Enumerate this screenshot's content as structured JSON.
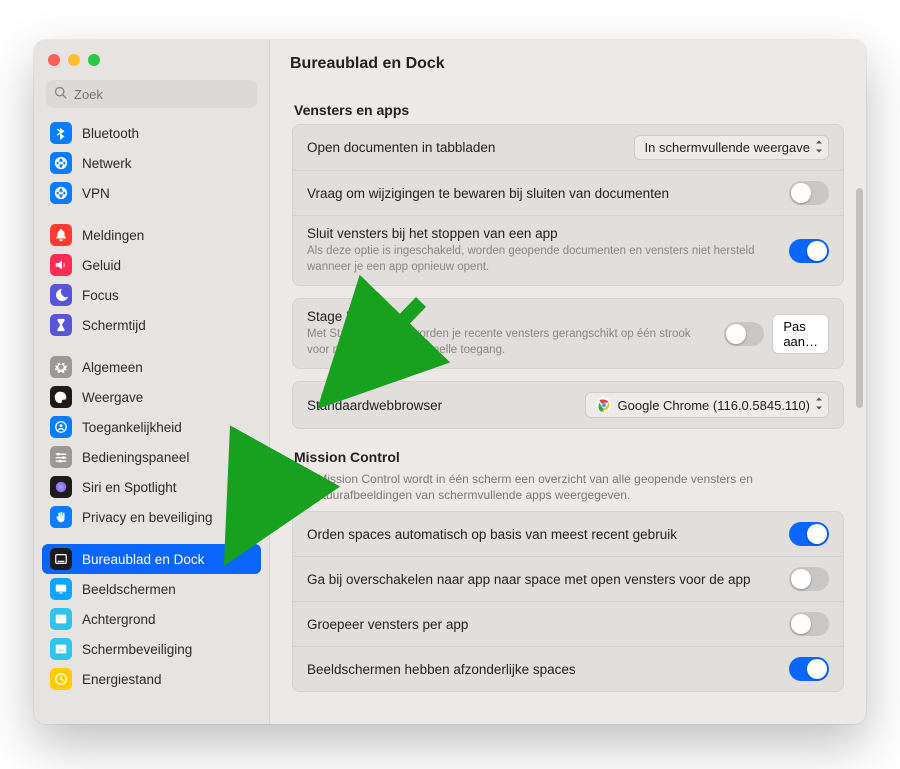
{
  "window": {
    "title": "Bureaublad en Dock"
  },
  "search": {
    "placeholder": "Zoek"
  },
  "sidebar": {
    "groups": [
      [
        {
          "id": "bluetooth",
          "label": "Bluetooth",
          "color": "#0a7cff",
          "icon": "bluetooth"
        },
        {
          "id": "network",
          "label": "Netwerk",
          "color": "#0a7cff",
          "icon": "globe"
        },
        {
          "id": "vpn",
          "label": "VPN",
          "color": "#0a7cff",
          "icon": "globe"
        }
      ],
      [
        {
          "id": "notifications",
          "label": "Meldingen",
          "color": "#ff3b30",
          "icon": "bell"
        },
        {
          "id": "sound",
          "label": "Geluid",
          "color": "#ff2d55",
          "icon": "speaker"
        },
        {
          "id": "focus",
          "label": "Focus",
          "color": "#5856d6",
          "icon": "moon"
        },
        {
          "id": "screentime",
          "label": "Schermtijd",
          "color": "#5856d6",
          "icon": "hourglass"
        }
      ],
      [
        {
          "id": "general",
          "label": "Algemeen",
          "color": "#9b9895",
          "icon": "gear"
        },
        {
          "id": "appearance",
          "label": "Weergave",
          "color": "#1c1c1c",
          "icon": "appearance"
        },
        {
          "id": "accessibility",
          "label": "Toegankelijkheid",
          "color": "#0a7cff",
          "icon": "person"
        },
        {
          "id": "controlcenter",
          "label": "Bedieningspaneel",
          "color": "#9b9895",
          "icon": "sliders"
        },
        {
          "id": "siri",
          "label": "Siri en Spotlight",
          "color": "#1c1c1c",
          "icon": "siri"
        },
        {
          "id": "privacy",
          "label": "Privacy en beveiliging",
          "color": "#0a7cff",
          "icon": "hand"
        }
      ],
      [
        {
          "id": "desktop",
          "label": "Bureaublad en Dock",
          "color": "#1c1c1c",
          "icon": "dock",
          "selected": true
        },
        {
          "id": "displays",
          "label": "Beeldschermen",
          "color": "#0aa6ff",
          "icon": "displays"
        },
        {
          "id": "wallpaper",
          "label": "Achtergrond",
          "color": "#2ec4ec",
          "icon": "wallpaper"
        },
        {
          "id": "screensaver",
          "label": "Schermbeveiliging",
          "color": "#2ec4ec",
          "icon": "screensaver"
        },
        {
          "id": "energy",
          "label": "Energiestand",
          "color": "#ffcc00",
          "icon": "battery"
        }
      ]
    ]
  },
  "sections": {
    "windows_apps": {
      "heading": "Vensters en apps",
      "open_docs_label": "Open documenten in tabbladen",
      "open_docs_value": "In schermvullende weergave",
      "ask_save_label": "Vraag om wijzigingen te bewaren bij sluiten van documenten",
      "ask_save_on": false,
      "close_windows_label": "Sluit vensters bij het stoppen van een app",
      "close_windows_sub": "Als deze optie is ingeschakeld, worden geopende documenten en vensters niet hersteld wanneer je een app opnieuw opent.",
      "close_windows_on": true
    },
    "stage_manager": {
      "label": "Stage Manager",
      "sub": "Met Stage Manager worden je recente vensters gerangschikt op één strook voor meer overzicht en snelle toegang.",
      "on": false,
      "customize": "Pas aan…"
    },
    "default_browser": {
      "label": "Standaardwebbrowser",
      "value": "Google Chrome (116.0.5845.110)"
    },
    "mission_control": {
      "heading": "Mission Control",
      "sub": "Met Mission Control wordt in één scherm een overzicht van alle geopende vensters en miniatuurafbeeldingen van schermvullende apps weergegeven.",
      "auto_spaces_label": "Orden spaces automatisch op basis van meest recent gebruik",
      "auto_spaces_on": true,
      "switch_space_label": "Ga bij overschakelen naar app naar space met open vensters voor de app",
      "switch_space_on": false,
      "group_windows_label": "Groepeer vensters per app",
      "group_windows_on": false,
      "separate_spaces_label": "Beeldschermen hebben afzonderlijke spaces",
      "separate_spaces_on": true
    }
  }
}
